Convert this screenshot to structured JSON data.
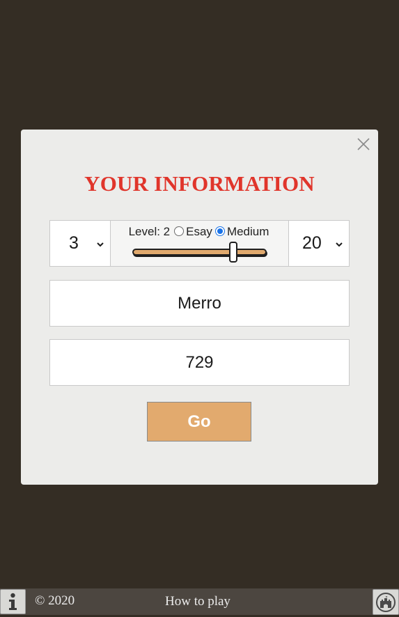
{
  "modal": {
    "title": "YOUR INFORMATION",
    "close_icon": "close-icon"
  },
  "settings": {
    "left_select": {
      "value": "3",
      "icon": "chevron-down-icon"
    },
    "level": {
      "label": "Level: 2",
      "options": [
        {
          "label": "Esay",
          "checked": false
        },
        {
          "label": "Medium",
          "checked": true
        }
      ],
      "slider_value_fraction": 0.75
    },
    "right_select": {
      "value": "20",
      "icon": "chevron-down-icon"
    }
  },
  "fields": {
    "name_value": "Merro",
    "number_value": "729"
  },
  "go_button": {
    "label": "Go"
  },
  "footer": {
    "copyright": "© 2020",
    "how_to_play": "How to play",
    "info_icon": "info-icon",
    "castle_icon": "castle-icon"
  },
  "colors": {
    "background": "#342d24",
    "modal": "#ececea",
    "title": "#e0352b",
    "accent": "#e2aa6e",
    "radio_checked": "#1a73e8"
  }
}
